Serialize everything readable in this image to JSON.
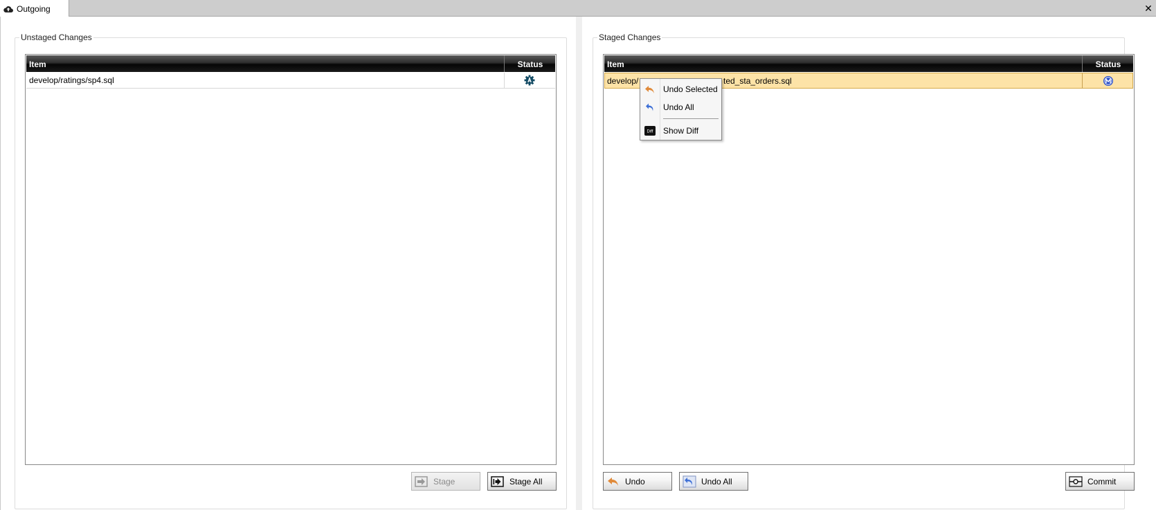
{
  "tab": {
    "title": "Outgoing",
    "icon": "cloud-upload-icon"
  },
  "window": {
    "close_glyph": "✕"
  },
  "unstaged": {
    "title": "Unstaged Changes",
    "columns": {
      "item": "Item",
      "status": "Status"
    },
    "rows": [
      {
        "item": "develop/ratings/sp4.sql",
        "status_icon": "gear-status-icon"
      }
    ],
    "buttons": {
      "stage": "Stage",
      "stage_all": "Stage All"
    }
  },
  "staged": {
    "title": "Staged Changes",
    "columns": {
      "item": "Item",
      "status": "Status"
    },
    "rows": [
      {
        "item_visible_start": "develop/",
        "item_visible_end": "ted_sta_orders.sql",
        "status_icon": "modified-m-icon",
        "selected": true
      }
    ],
    "buttons": {
      "undo": "Undo",
      "undo_all": "Undo All",
      "commit": "Commit"
    }
  },
  "context_menu": {
    "items": [
      {
        "label": "Undo Selected",
        "icon": "undo-arrow-icon"
      },
      {
        "label": "Undo All",
        "icon": "undo-all-icon"
      },
      {
        "label": "Show Diff",
        "icon": "diff-icon"
      }
    ],
    "diff_icon_text": "Diff"
  },
  "colors": {
    "selection": "#fde3a7",
    "header_dark": "#050505",
    "status_gear": "#134b64",
    "status_m": "#2a4fc9",
    "undo_orange": "#e08a3a",
    "undo_blue": "#3d6fd6"
  }
}
